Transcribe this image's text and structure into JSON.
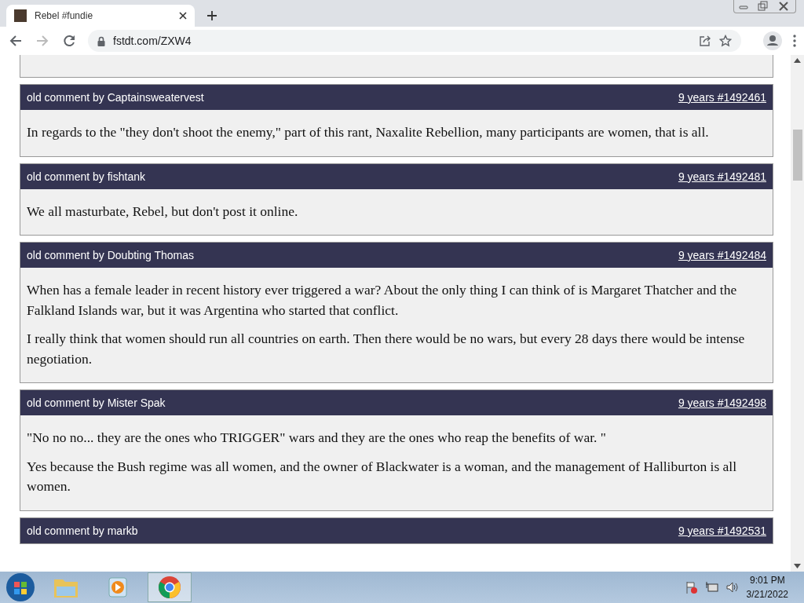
{
  "browser": {
    "tab_title": "Rebel #fundie",
    "url": "fstdt.com/ZXW4"
  },
  "comments": [
    {
      "prefix": "old comment by",
      "author": "Captainsweatervest",
      "meta": "9 years #1492461",
      "paragraphs": [
        "In regards to the \"they don't shoot the enemy,\" part of this rant, Naxalite Rebellion, many participants are women, that is all."
      ]
    },
    {
      "prefix": "old comment by",
      "author": "fishtank",
      "meta": "9 years #1492481",
      "paragraphs": [
        "We all masturbate, Rebel, but don't post it online."
      ]
    },
    {
      "prefix": "old comment by",
      "author": "Doubting Thomas",
      "meta": "9 years #1492484",
      "paragraphs": [
        "When has a female leader in recent history ever triggered a war? About the only thing I can think of is Margaret Thatcher and the Falkland Islands war, but it was Argentina who started that conflict.",
        "I really think that women should run all countries on earth. Then there would be no wars, but every 28 days there would be intense negotiation."
      ]
    },
    {
      "prefix": "old comment by",
      "author": "Mister Spak",
      "meta": "9 years #1492498",
      "paragraphs": [
        "\"No no no... they are the ones who TRIGGER\" wars and they are the ones who reap the benefits of war. \"",
        "Yes because the Bush regime was all women, and the owner of Blackwater is a woman, and the management of Halliburton is all women."
      ]
    },
    {
      "prefix": "old comment by",
      "author": "markb",
      "meta": "9 years #1492531"
    }
  ],
  "taskbar": {
    "time": "9:01 PM",
    "date": "3/21/2022"
  }
}
